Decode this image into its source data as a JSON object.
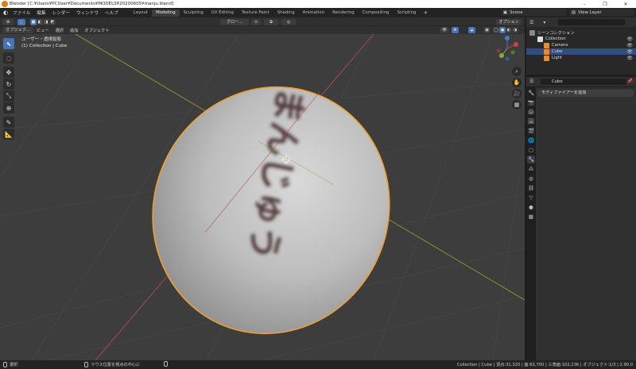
{
  "window": {
    "title": "Blender [C:¥Users¥PCUser¥Documents¥MODELS¥20200605¥manju.blend]",
    "controls": [
      "–",
      "❐",
      "✕"
    ]
  },
  "menus": [
    "ファイル",
    "編集",
    "レンダー",
    "ウィンドウ",
    "ヘルプ"
  ],
  "workspaces": {
    "tabs": [
      "Layout",
      "Modeling",
      "Sculpting",
      "UV Editing",
      "Texture Paint",
      "Shading",
      "Animation",
      "Rendering",
      "Compositing",
      "Scripting"
    ],
    "active": "Modeling",
    "add": "+"
  },
  "scene": {
    "label": "Scene",
    "view_layer": "View Layer"
  },
  "viewport_header": {
    "mode": "オブジェク...",
    "menus": [
      "ビュー",
      "選択",
      "追加",
      "オブジェクト"
    ],
    "transform": "グロー..."
  },
  "viewport": {
    "info_line1": "ユーザー・透視投影",
    "info_line2": "(1) Collection | Cube",
    "embossed_text": "まんじゅう"
  },
  "outliner": {
    "search_placeholder": "",
    "scene_collection": "シーンコレクション",
    "items": [
      {
        "name": "Collection",
        "type": "collection",
        "selected": false
      },
      {
        "name": "Camera",
        "type": "camera",
        "selected": false
      },
      {
        "name": "Cube",
        "type": "mesh",
        "selected": true
      },
      {
        "name": "Light",
        "type": "light",
        "selected": false
      }
    ]
  },
  "properties": {
    "object_name": "Cube",
    "add_modifier": "モディファイアーを追加"
  },
  "statusbar": {
    "left_label": "選択",
    "mid_label": "マウス位置を視点の中心に",
    "stats": "Collection | Cube | 頂点:31,320 | 面:62,700 | 三角面:102,236 | オブジェクト:1/3 | 2.90.0"
  },
  "colors": {
    "accent": "#4772b3",
    "selection_outline": "#f0a030",
    "x_axis": "#b04a55",
    "y_axis": "#88a030"
  }
}
